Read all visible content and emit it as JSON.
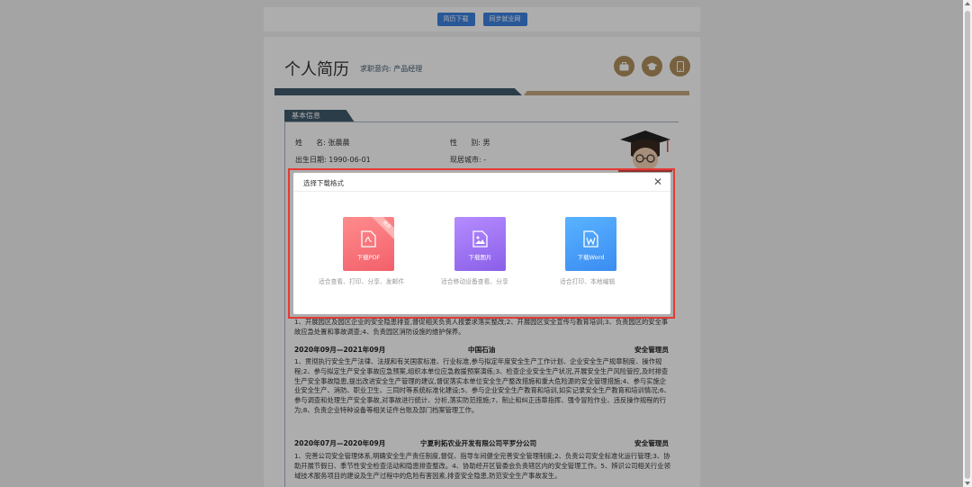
{
  "toolbar": {
    "download_label": "简历下载",
    "sync_label": "同步就业网"
  },
  "resume": {
    "title": "个人简历",
    "intent_label": "求职意向:",
    "intent_value": "产品经理",
    "header_icons": [
      "briefcase-icon",
      "graduation-cap-icon",
      "phone-icon"
    ],
    "section_basic": "基本信息",
    "name_label": "姓      名:",
    "name_value": "张晨晨",
    "gender_label": "性      别:",
    "gender_value": "男",
    "birth_label": "出生日期:",
    "birth_value": "1990-06-01",
    "city_label": "现居城市:",
    "city_value": "-",
    "job1_desc": "1、开展园区及园区企业的安全隐患排查,督促相关负责人按要求落实整改;2、开展园区安全宣传与教育培训;3、负责园区的安全事故应急处置和事故调查;4、负责园区消防设施的维护保养。",
    "job2_period": "2020年09月—2021年09月",
    "job2_company": "中国石油",
    "job2_title": "安全管理员",
    "job2_desc": "1、贯彻执行安全生产法律、法规和有关国家标准、行业标准,参与拟定年度安全生产工作计划、企业安全生产规章制度、操作规程;2、参与拟定生产安全事故应急预案,组织本单位应急救援预案演练;3、检查企业安全生产状况,开展安全生产风险管控,及时排查生产安全事故隐患,提出改进安全生产管理的建议,督促落实本单位安全生产整改措施和重大危险源的安全管理措施;4、参与实施企业安全生产、消防、职业卫生、三同时等系统标准化建设;5、参与企业安全生产教育和培训,如实记录安全生产教育和培训情况;6、参与调查和处理生产安全事故,对事故进行统计、分析,落实防范措施;7、制止和纠正违章指挥、强令冒险作业、违反操作规程的行为;8、负责企业特种设备等相关证件台账及部门档案管理工作。",
    "job3_period": "2020年07月—2020年09月",
    "job3_company": "宁夏利拓农业开发有限公司平罗分公司",
    "job3_title": "安全管理员",
    "job3_desc": "1、完善公司安全管理体系,明确安全生产责任制度,督促、指导车间健全完善安全管理制度;2、负责公司安全标准化运行管理;3、协助开展节假日、季节性安全检查活动和隐患排查整改。4、协助经开区管委会负责辖区内的安全管理工作。5、辨识公司相关行业领域技术服务项目的建设及生产过程中的危险有害因素,排查安全隐患,防范安全生产事故发生。"
  },
  "modal": {
    "title": "选择下载格式",
    "close_glyph": "✕",
    "options": [
      {
        "label": "下载PDF",
        "desc": "适合查看、打印、分享、发邮件",
        "ribbon": "推荐"
      },
      {
        "label": "下载图片",
        "desc": "适合移动设备查看、分享"
      },
      {
        "label": "下载Word",
        "desc": "适合打印、本地编辑"
      }
    ]
  },
  "colors": {
    "accent": "#3d82e0",
    "highlight": "#e53935",
    "pdf": "#f2606b",
    "image": "#8a5fe8",
    "word": "#3b8cf2",
    "gold": "#b08f5e"
  }
}
